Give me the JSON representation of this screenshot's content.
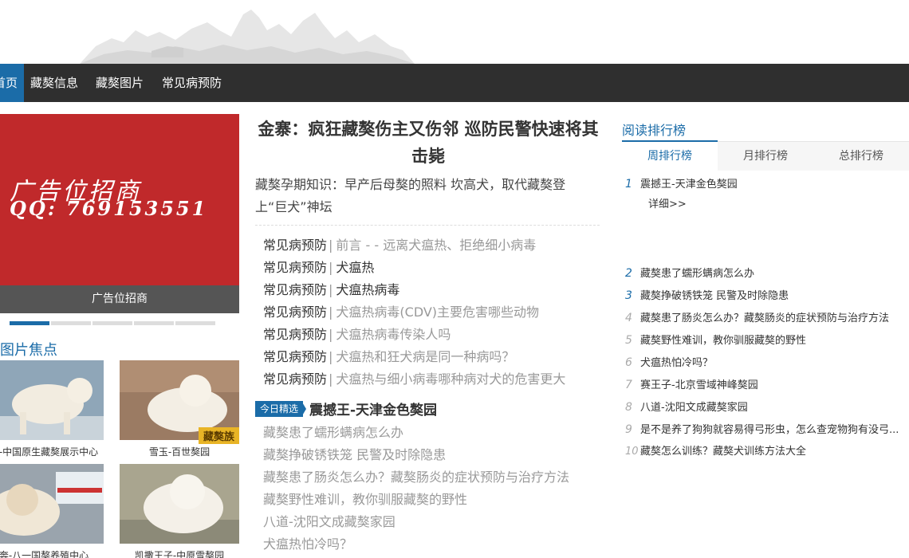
{
  "nav": {
    "items": [
      {
        "label": "首页"
      },
      {
        "label": "藏獒信息"
      },
      {
        "label": "藏獒图片"
      },
      {
        "label": "常见病预防"
      }
    ]
  },
  "banner": {
    "text_line1": "广告位招商",
    "text_line2": "QQ: 769153551",
    "caption": "广告位招商"
  },
  "photos": {
    "title": "今日图片焦点",
    "items": [
      {
        "caption": "达-中国原生藏獒展示中心"
      },
      {
        "caption": "雪玉-百世獒园",
        "tag": "藏獒族"
      },
      {
        "caption": "奔-八一国獒养殖中心"
      },
      {
        "caption": "凯撒王子-中原雪獒园"
      }
    ]
  },
  "headline": {
    "title": "金寨：疯狂藏獒伤主又伤邻 巡防民警快速将其击毙",
    "subtitle": "藏獒孕期知识：早产后母獒的照料 坎高犬，取代藏獒登上“巨犬”神坛"
  },
  "news": {
    "separator": "|",
    "items": [
      {
        "category": "常见病预防",
        "title": "前言 - - 远离犬瘟热、拒绝细小病毒"
      },
      {
        "category": "常见病预防",
        "title": "犬瘟热"
      },
      {
        "category": "常见病预防",
        "title": "犬瘟热病毒"
      },
      {
        "category": "常见病预防",
        "title": "犬瘟热病毒(CDV)主要危害哪些动物"
      },
      {
        "category": "常见病预防",
        "title": "犬瘟热病毒传染人吗"
      },
      {
        "category": "常见病预防",
        "title": "犬瘟热和狂犬病是同一种病吗？"
      },
      {
        "category": "常见病预防",
        "title": "犬瘟热与细小病毒哪种病对犬的危害更大"
      }
    ]
  },
  "todays_pick": {
    "badge": "今日精选",
    "title": "震撼王-天津金色獒园",
    "items": [
      "藏獒患了蠕形螨病怎么办",
      "藏獒挣破锈铁笼 民警及时除隐患",
      "藏獒患了肠炎怎么办？藏獒肠炎的症状预防与治疗方法",
      "藏獒野性难训，教你驯服藏獒的野性",
      "八道-沈阳文成藏獒家园",
      "犬瘟热怕冷吗？"
    ]
  },
  "ranking": {
    "title": "阅读排行榜",
    "tabs": [
      "周排行榜",
      "月排行榜",
      "总排行榜"
    ],
    "detail_label": "详细>>",
    "items": [
      {
        "num": "1",
        "title": "震撼王-天津金色獒园"
      },
      {
        "num": "2",
        "title": "藏獒患了蠕形螨病怎么办"
      },
      {
        "num": "3",
        "title": "藏獒挣破锈铁笼 民警及时除隐患"
      },
      {
        "num": "4",
        "title": "藏獒患了肠炎怎么办？藏獒肠炎的症状预防与治疗方法"
      },
      {
        "num": "5",
        "title": "藏獒野性难训，教你驯服藏獒的野性"
      },
      {
        "num": "6",
        "title": "犬瘟热怕冷吗？"
      },
      {
        "num": "7",
        "title": "赛王子-北京雪域神峰獒园"
      },
      {
        "num": "8",
        "title": "八道-沈阳文成藏獒家园"
      },
      {
        "num": "9",
        "title": "是不是养了狗狗就容易得弓形虫，怎么查宠物狗有没弓..."
      },
      {
        "num": "10",
        "title": "藏獒怎么训练？藏獒犬训练方法大全"
      }
    ]
  },
  "colors": {
    "accent": "#1b6ca8",
    "nav_bg": "#2f2f2f",
    "banner_red": "#c0292b"
  }
}
